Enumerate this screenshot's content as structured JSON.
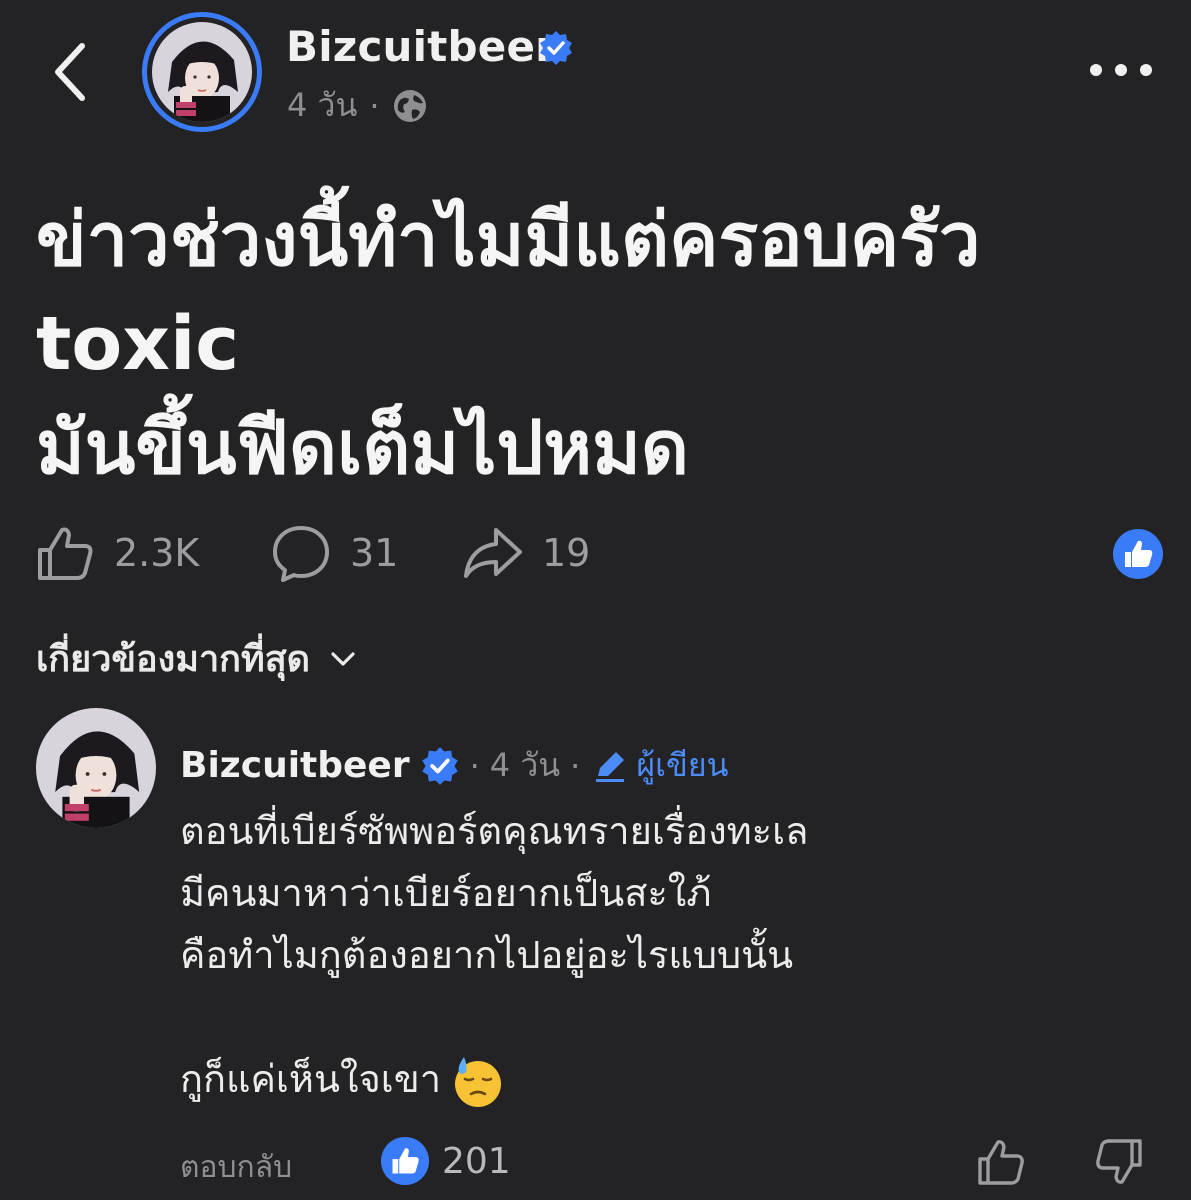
{
  "header": {
    "author_name": "Bizcuitbeer",
    "time": "4 วัน",
    "separator": "·",
    "icons": {
      "back": "chevron-left-icon",
      "verified": "verified-badge-icon",
      "audience": "globe-icon",
      "more": "more-horizontal-icon"
    }
  },
  "post": {
    "lines": [
      "ข่าวช่วงนี้ทำไมมีแต่ครอบครัว",
      "toxic",
      "มันขึ้นฟีดเต็มไปหมด"
    ]
  },
  "actions": {
    "likes": "2.3K",
    "comments": "31",
    "shares": "19",
    "icons": {
      "like": "thumbs-up-icon",
      "comment": "comment-bubble-icon",
      "share": "share-arrow-icon",
      "reaction": "like-reaction-icon"
    }
  },
  "sort": {
    "label": "เกี่ยวข้องมากที่สุด",
    "icon": "chevron-down-icon"
  },
  "comment": {
    "author_name": "Bizcuitbeer",
    "separator": "·",
    "time": "4 วัน",
    "author_label": "ผู้เขียน",
    "lines": [
      "ตอนที่เบียร์ซัพพอร์ตคุณทรายเรื่องทะเล",
      "มีคนมาหาว่าเบียร์อยากเป็นสะใภ้",
      "คือทำไมกูต้องอยากไปอยู่อะไรแบบนั้น",
      "",
      "กูก็แค่เห็นใจเขา"
    ],
    "emoji": "downcast-sweat-face-emoji",
    "reply_label": "ตอบกลับ",
    "reaction_count": "201"
  },
  "colors": {
    "background": "#232325",
    "accent": "#3a7bf7",
    "text": "#f0f0f0",
    "muted": "#8e8e93"
  }
}
